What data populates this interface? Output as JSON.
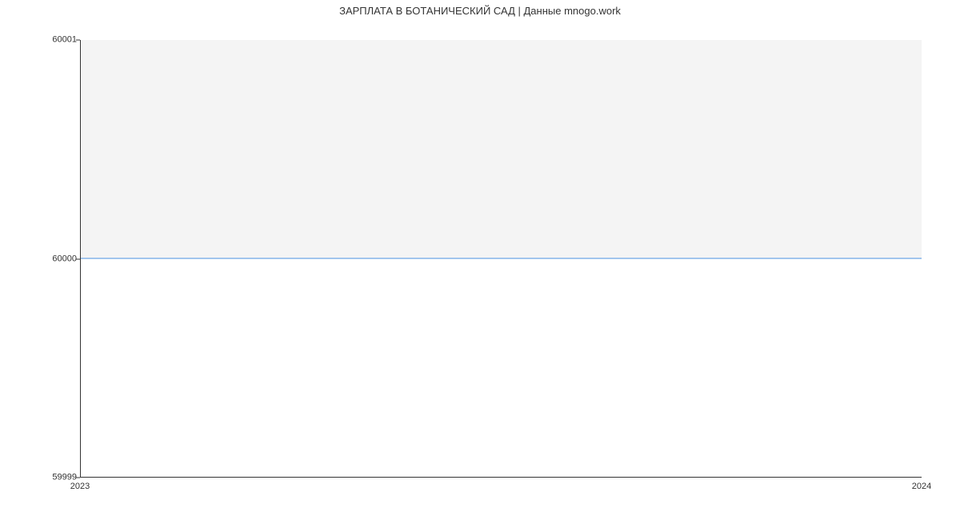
{
  "chart_data": {
    "type": "line",
    "title": "ЗАРПЛАТА В БОТАНИЧЕСКИЙ САД | Данные mnogo.work",
    "x": [
      "2023",
      "2024"
    ],
    "values": [
      60000,
      60000
    ],
    "xlabel": "",
    "ylabel": "",
    "ylim": [
      59999,
      60001
    ],
    "y_ticks": [
      "59999",
      "60000",
      "60001"
    ],
    "x_ticks": [
      "2023",
      "2024"
    ],
    "line_color": "#4a90e2"
  }
}
